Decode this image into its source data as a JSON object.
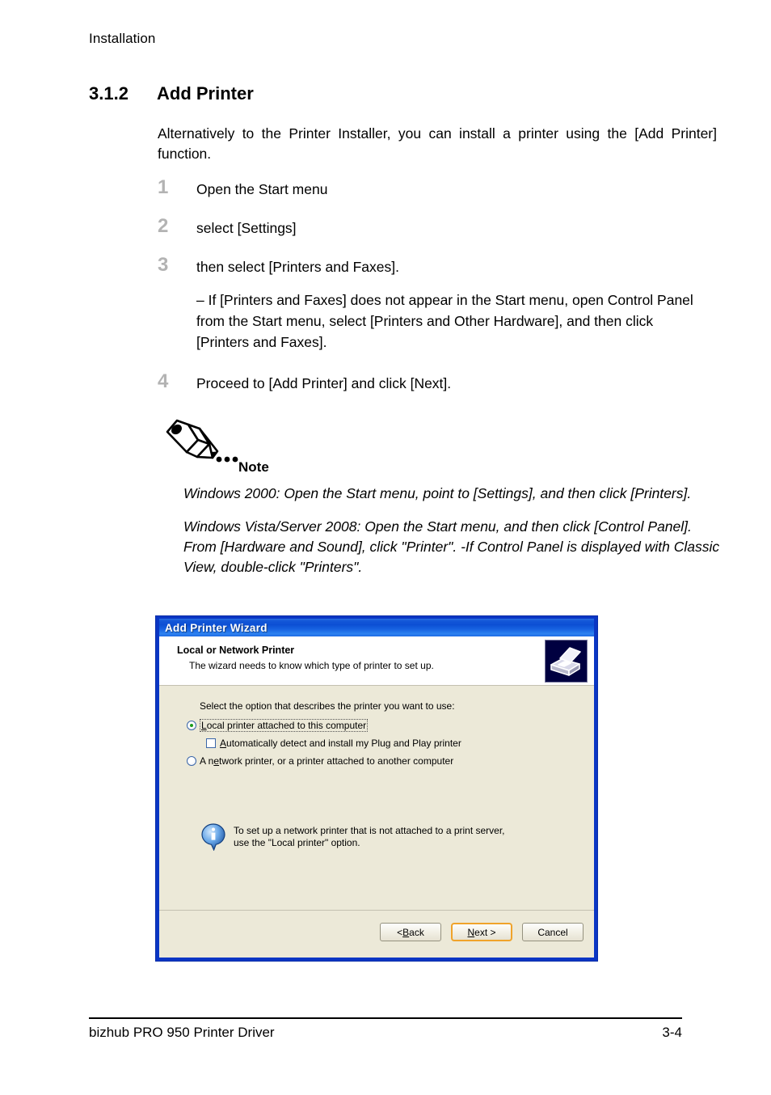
{
  "page": {
    "running_header": "Installation",
    "section_number": "3.1.2",
    "section_title": "Add Printer",
    "intro": "Alternatively to the Printer Installer, you can install a printer using the [Add Printer] function."
  },
  "steps": [
    {
      "num": "1",
      "text": "Open the Start menu",
      "sub": ""
    },
    {
      "num": "2",
      "text": "select [Settings]",
      "sub": ""
    },
    {
      "num": "3",
      "text": "then select [Printers and Faxes].",
      "sub": "– If [Printers and Faxes] does not appear in the Start menu, open Control Panel from the Start menu, select [Printers and Other Hardware], and then click [Printers and Faxes]."
    },
    {
      "num": "4",
      "text": "Proceed to [Add Printer] and click [Next].",
      "sub": ""
    }
  ],
  "note": {
    "label": "Note",
    "icon": "pencil-icon",
    "paragraphs": [
      "Windows 2000: Open the Start menu, point to [Settings], and then click [Printers].",
      "Windows Vista/Server 2008: Open the Start menu, and then click [Control Panel]. From [Hardware and Sound], click \"Printer\". -If Control Panel is displayed with Classic View, double-click \"Printers\"."
    ]
  },
  "dialog": {
    "title": "Add Printer Wizard",
    "banner": {
      "title": "Local or Network Printer",
      "subtitle": "The wizard needs to know which type of printer to set up.",
      "icon": "printer-icon"
    },
    "prompt": "Select the option that describes the printer you want to use:",
    "options": {
      "local_radio": {
        "label": "Local printer attached to this computer",
        "accel": "L",
        "rest": "ocal printer attached to this computer",
        "selected": true
      },
      "autodetect_check": {
        "accel": "A",
        "rest": "utomatically detect and install my Plug and Play printer",
        "checked": false
      },
      "network_radio": {
        "pre": "A n",
        "accel": "e",
        "rest": "twork printer, or a printer attached to another computer",
        "selected": false
      }
    },
    "info": {
      "icon": "info-icon",
      "line1": "To set up a network printer that is not attached to a print server,",
      "line2": "use the \"Local printer\" option."
    },
    "buttons": {
      "back": {
        "pre": "< ",
        "accel": "B",
        "rest": "ack"
      },
      "next": {
        "accel": "N",
        "rest": "ext >",
        "is_default": true
      },
      "cancel": {
        "label": "Cancel"
      }
    },
    "colors": {
      "titlebar_blue": "#0c4fd4",
      "frame_blue": "#0a36c4",
      "body_beige": "#ece9d8",
      "default_button_outline": "#f0a32a",
      "radio_dot_green": "#1c9c1c"
    }
  },
  "footer": {
    "left": "bizhub PRO 950 Printer Driver",
    "right": "3-4"
  }
}
